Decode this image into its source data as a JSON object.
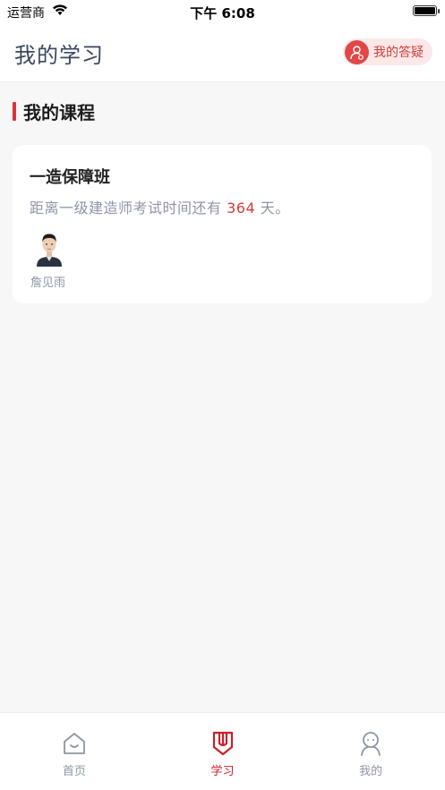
{
  "status_bar": {
    "carrier": "运营商",
    "time": "下午 6:08"
  },
  "header": {
    "title": "我的学习",
    "qa_button_label": "我的答疑"
  },
  "section": {
    "heading": "我的课程"
  },
  "course": {
    "title": "一造保障班",
    "countdown_prefix": "距离一级建造师考试时间还有 ",
    "countdown_days": "364",
    "countdown_suffix": " 天。",
    "teacher_name": "詹见雨"
  },
  "tabs": [
    {
      "label": "首页",
      "icon": "home-icon",
      "active": false
    },
    {
      "label": "学习",
      "icon": "book-icon",
      "active": true
    },
    {
      "label": "我的",
      "icon": "profile-icon",
      "active": false
    }
  ],
  "colors": {
    "accent": "#c8202b",
    "title_text": "#3b4660",
    "muted_text": "#8d95a6",
    "page_bg": "#f7f7f8"
  }
}
